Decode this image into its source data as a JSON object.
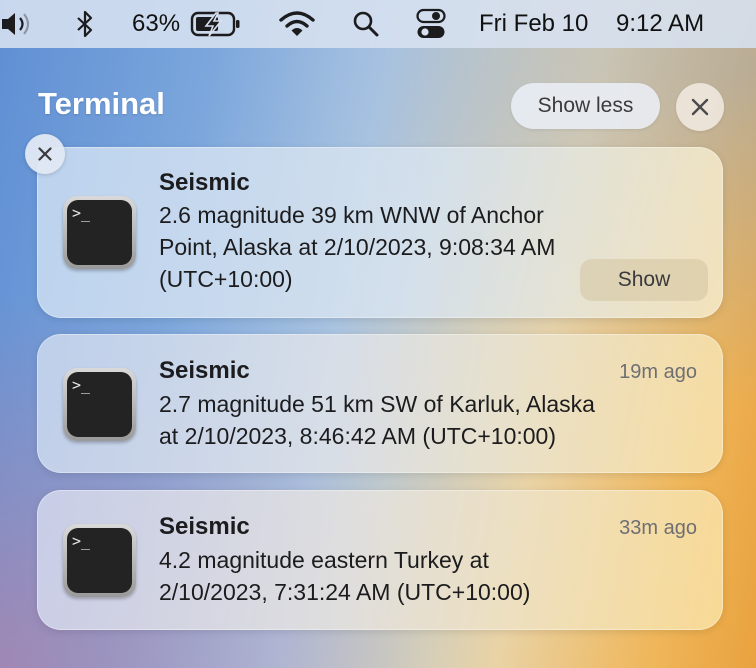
{
  "menubar": {
    "battery_percent": "63%",
    "date": "Fri Feb 10",
    "time": "9:12 AM",
    "icons": [
      "volume-icon",
      "bluetooth-icon",
      "battery-charging-icon",
      "wifi-icon",
      "search-icon",
      "control-center-icon"
    ]
  },
  "notification_center": {
    "app_title": "Terminal",
    "show_less_label": "Show less",
    "close_all_icon": "close-icon"
  },
  "notifications": [
    {
      "title": "Seismic",
      "body_lines": [
        "2.6 magnitude 39 km WNW of Anchor",
        "Point, Alaska at 2/10/2023, 9:08:34 AM",
        "(UTC+10:00)"
      ],
      "action_label": "Show",
      "icon": "terminal-icon"
    },
    {
      "title": "Seismic",
      "time": "19m ago",
      "body_lines": [
        "2.7 magnitude 51 km SW of Karluk, Alaska",
        "at 2/10/2023, 8:46:42 AM (UTC+10:00)"
      ],
      "icon": "terminal-icon"
    },
    {
      "title": "Seismic",
      "time": "33m ago",
      "body_lines": [
        "4.2 magnitude eastern Turkey at",
        "2/10/2023, 7:31:24 AM (UTC+10:00)"
      ],
      "icon": "terminal-icon"
    }
  ],
  "terminal_prompt_glyph": ">_"
}
